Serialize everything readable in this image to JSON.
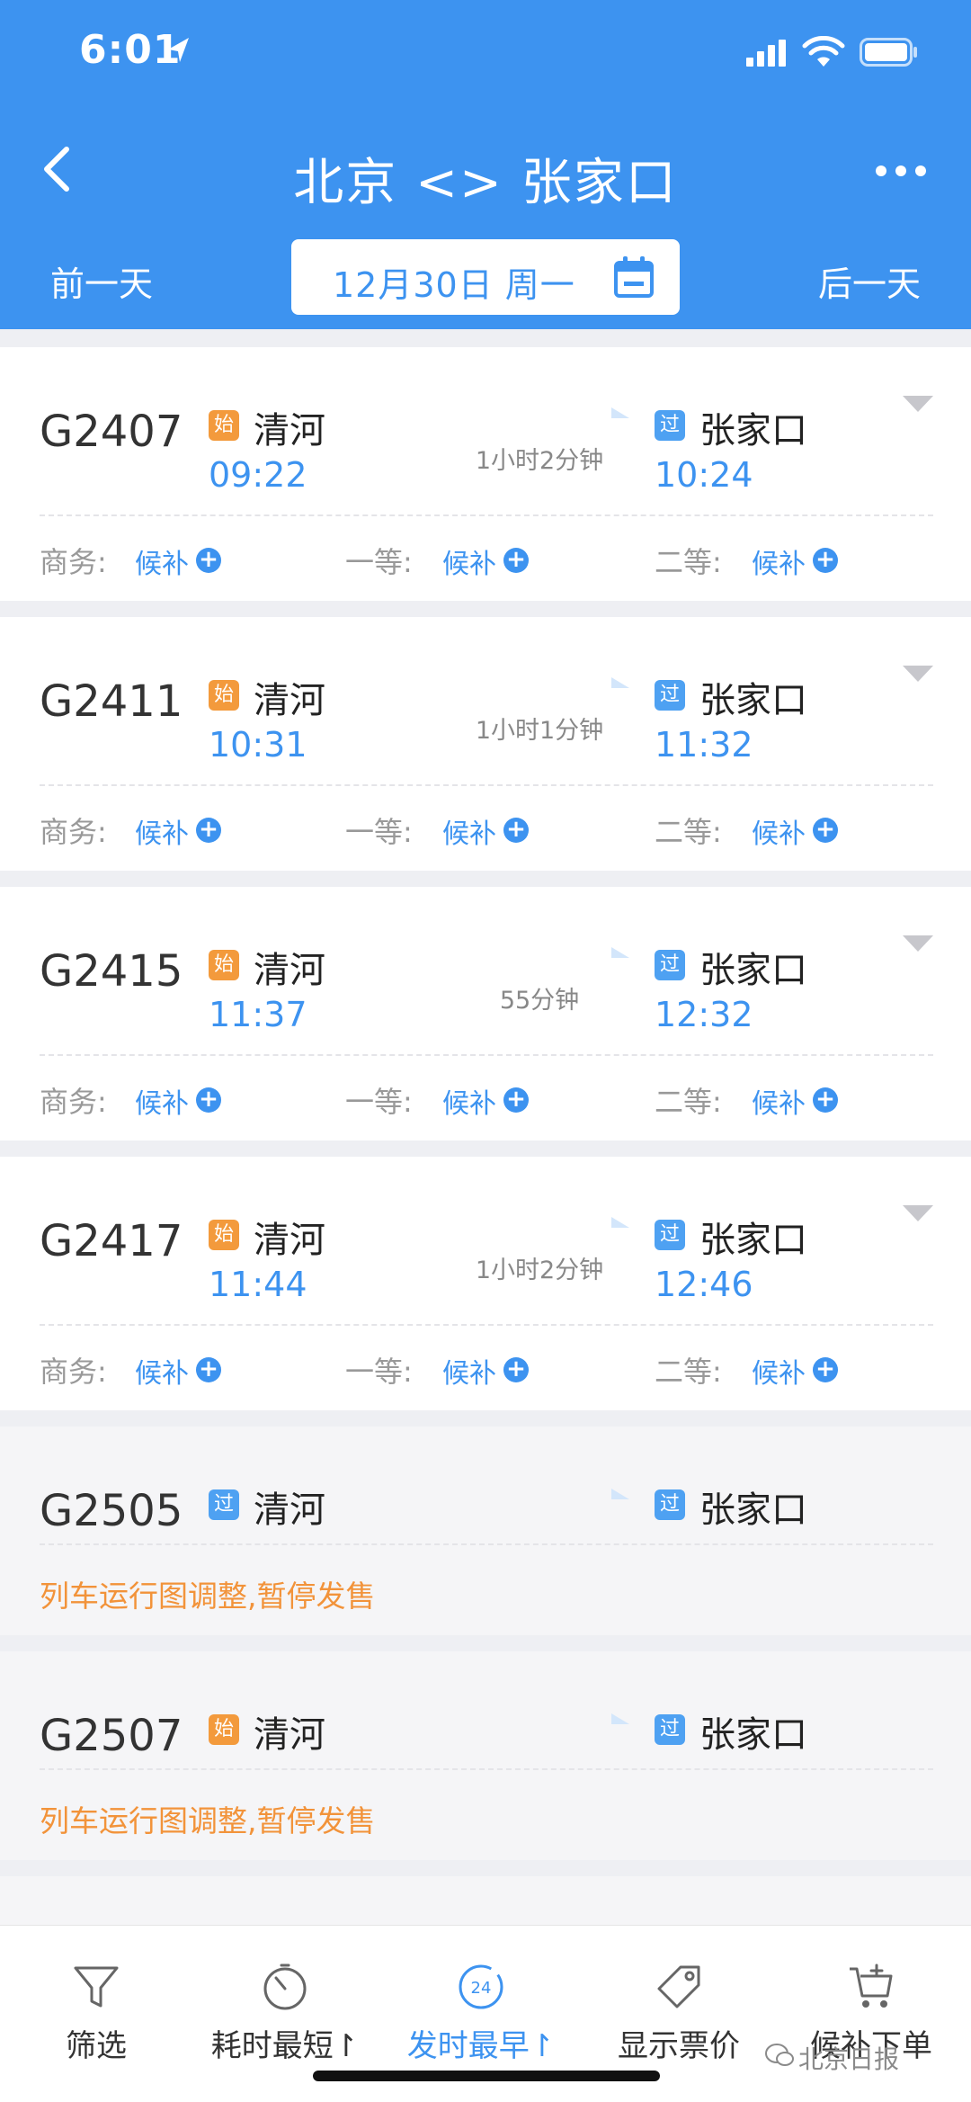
{
  "status_bar": {
    "time": "6:01"
  },
  "nav": {
    "title": "北京 <> 张家口"
  },
  "date_bar": {
    "prev_label": "前一天",
    "date": "12月30日 周一",
    "next_label": "后一天"
  },
  "seat_labels": {
    "business": "商务:",
    "first": "一等:",
    "second": "二等:"
  },
  "trains": [
    {
      "no": "G2407",
      "from_badge": "始",
      "from": "清河",
      "dep": "09:22",
      "duration": "1小时2分钟",
      "to_badge": "过",
      "to": "张家口",
      "arr": "10:24",
      "business": "候补",
      "first": "候补",
      "second": "候补"
    },
    {
      "no": "G2411",
      "from_badge": "始",
      "from": "清河",
      "dep": "10:31",
      "duration": "1小时1分钟",
      "to_badge": "过",
      "to": "张家口",
      "arr": "11:32",
      "business": "候补",
      "first": "候补",
      "second": "候补"
    },
    {
      "no": "G2415",
      "from_badge": "始",
      "from": "清河",
      "dep": "11:37",
      "duration": "55分钟",
      "to_badge": "过",
      "to": "张家口",
      "arr": "12:32",
      "business": "候补",
      "first": "候补",
      "second": "候补"
    },
    {
      "no": "G2417",
      "from_badge": "始",
      "from": "清河",
      "dep": "11:44",
      "duration": "1小时2分钟",
      "to_badge": "过",
      "to": "张家口",
      "arr": "12:46",
      "business": "候补",
      "first": "候补",
      "second": "候补"
    },
    {
      "no": "G2505",
      "from_badge": "过",
      "from": "清河",
      "to_badge": "过",
      "to": "张家口",
      "notice": "列车运行图调整,暂停发售"
    },
    {
      "no": "G2507",
      "from_badge": "始",
      "from": "清河",
      "to_badge": "过",
      "to": "张家口",
      "notice": "列车运行图调整,暂停发售"
    }
  ],
  "bottom_tabs": [
    {
      "label": "筛选",
      "icon": "filter-icon"
    },
    {
      "label": "耗时最短↾",
      "icon": "timer-icon"
    },
    {
      "label": "发时最早↾",
      "icon": "clock-24-icon",
      "active": true
    },
    {
      "label": "显示票价",
      "icon": "price-tag-icon"
    },
    {
      "label": "候补下单",
      "icon": "cart-add-icon"
    }
  ],
  "watermark": "北京日报",
  "colors": {
    "primary": "#3d93f0",
    "start_badge": "#f39a3c",
    "pass_badge": "#4ea1f2",
    "notice": "#f2933a"
  }
}
